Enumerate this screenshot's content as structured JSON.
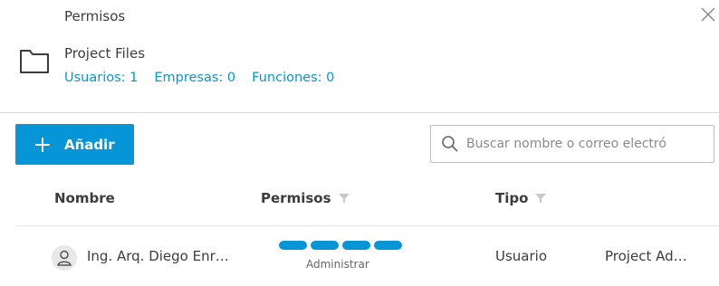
{
  "dialog": {
    "title": "Permisos",
    "close_icon": "close-icon"
  },
  "folder": {
    "icon": "folder-icon",
    "name": "Project Files",
    "counts": {
      "users": "Usuarios: 1",
      "companies": "Empresas: 0",
      "roles": "Funciones: 0"
    }
  },
  "toolbar": {
    "add_icon": "plus-icon",
    "add_label": "Añadir",
    "search_icon": "search-icon",
    "search_placeholder": "Buscar nombre o correo electró"
  },
  "table": {
    "columns": [
      {
        "label": "Nombre",
        "filter": false
      },
      {
        "label": "Permisos",
        "filter": true
      },
      {
        "label": "Tipo",
        "filter": true
      }
    ],
    "rows": [
      {
        "avatar_icon": "user-icon",
        "name": "Ing. Arq. Diego Enr…",
        "permission_level": 4,
        "permission_levels_total": 4,
        "permission_label": "Administrar",
        "type": "Usuario",
        "role": "Project Ad…"
      }
    ]
  },
  "colors": {
    "accent": "#0696d7",
    "text": "#3c3c3c",
    "divider": "#dcdcdc"
  }
}
